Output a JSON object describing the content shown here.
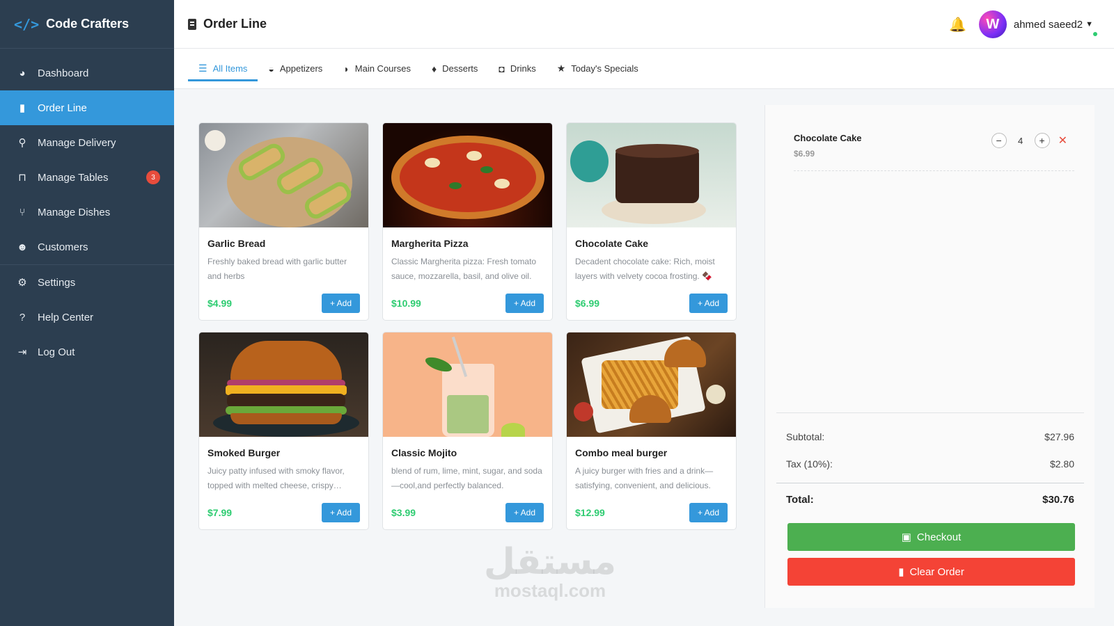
{
  "brand": {
    "icon": "</>",
    "name": "Code Crafters"
  },
  "sidebar": {
    "items": [
      {
        "label": "Dashboard",
        "icon": "dashboard-icon",
        "glyph": "◕"
      },
      {
        "label": "Order Line",
        "icon": "bookmark-icon",
        "glyph": "▮",
        "active": true
      },
      {
        "label": "Manage Delivery",
        "icon": "motorcycle-icon",
        "glyph": "⚲"
      },
      {
        "label": "Manage Tables",
        "icon": "chair-icon",
        "glyph": "⊓",
        "badge": "3"
      },
      {
        "label": "Manage Dishes",
        "icon": "utensils-icon",
        "glyph": "⑂"
      },
      {
        "label": "Customers",
        "icon": "users-icon",
        "glyph": "☻"
      },
      {
        "label": "Settings",
        "icon": "gear-icon",
        "glyph": "⚙"
      },
      {
        "label": "Help Center",
        "icon": "question-icon",
        "glyph": "?"
      },
      {
        "label": "Log Out",
        "icon": "logout-icon",
        "glyph": "⇥"
      }
    ]
  },
  "header": {
    "title": "Order Line",
    "username": "ahmed saeed2",
    "avatar_letter": "W"
  },
  "tabs": [
    {
      "label": "All Items",
      "icon": "list-icon",
      "glyph": "☰",
      "active": true
    },
    {
      "label": "Appetizers",
      "icon": "bowl-icon",
      "glyph": "◒"
    },
    {
      "label": "Main Courses",
      "icon": "drumstick-icon",
      "glyph": "◗"
    },
    {
      "label": "Desserts",
      "icon": "ice-cream-icon",
      "glyph": "♦"
    },
    {
      "label": "Drinks",
      "icon": "cup-icon",
      "glyph": "◘"
    },
    {
      "label": "Today's Specials",
      "icon": "star-icon",
      "glyph": "★"
    }
  ],
  "menu": {
    "add_label": "+ Add",
    "items": [
      {
        "name": "Garlic Bread",
        "desc": "Freshly baked bread with garlic butter and herbs",
        "price": "$4.99"
      },
      {
        "name": "Margherita Pizza",
        "desc": "Classic Margherita pizza: Fresh tomato sauce, mozzarella, basil, and olive oil.",
        "price": "$10.99"
      },
      {
        "name": "Chocolate Cake",
        "desc": "Decadent chocolate cake: Rich, moist layers with velvety cocoa frosting. 🍫",
        "price": "$6.99"
      },
      {
        "name": "Smoked Burger",
        "desc": "Juicy patty infused with smoky flavor, topped with melted cheese, crispy onions.",
        "price": "$7.99"
      },
      {
        "name": "Classic Mojito",
        "desc": "blend of rum, lime, mint, sugar, and soda—cool,and perfectly balanced.",
        "price": "$3.99"
      },
      {
        "name": "Combo meal burger",
        "desc": "A juicy burger with fries and a drink—satisfying, convenient, and delicious.",
        "price": "$12.99"
      }
    ]
  },
  "order": {
    "items": [
      {
        "name": "Chocolate Cake",
        "price": "$6.99",
        "qty": "4"
      }
    ],
    "subtotal_label": "Subtotal:",
    "subtotal": "$27.96",
    "tax_label": "Tax (10%):",
    "tax": "$2.80",
    "total_label": "Total:",
    "total": "$30.76",
    "checkout_label": "Checkout",
    "clear_label": "Clear Order"
  },
  "watermark": {
    "arabic": "مستقل",
    "latin": "mostaql.com"
  },
  "colors": {
    "sidebar": "#2c3e50",
    "accent": "#3498db",
    "price": "#2ecc71",
    "checkout": "#4caf50",
    "clear": "#f44336",
    "badge": "#e74c3c"
  }
}
